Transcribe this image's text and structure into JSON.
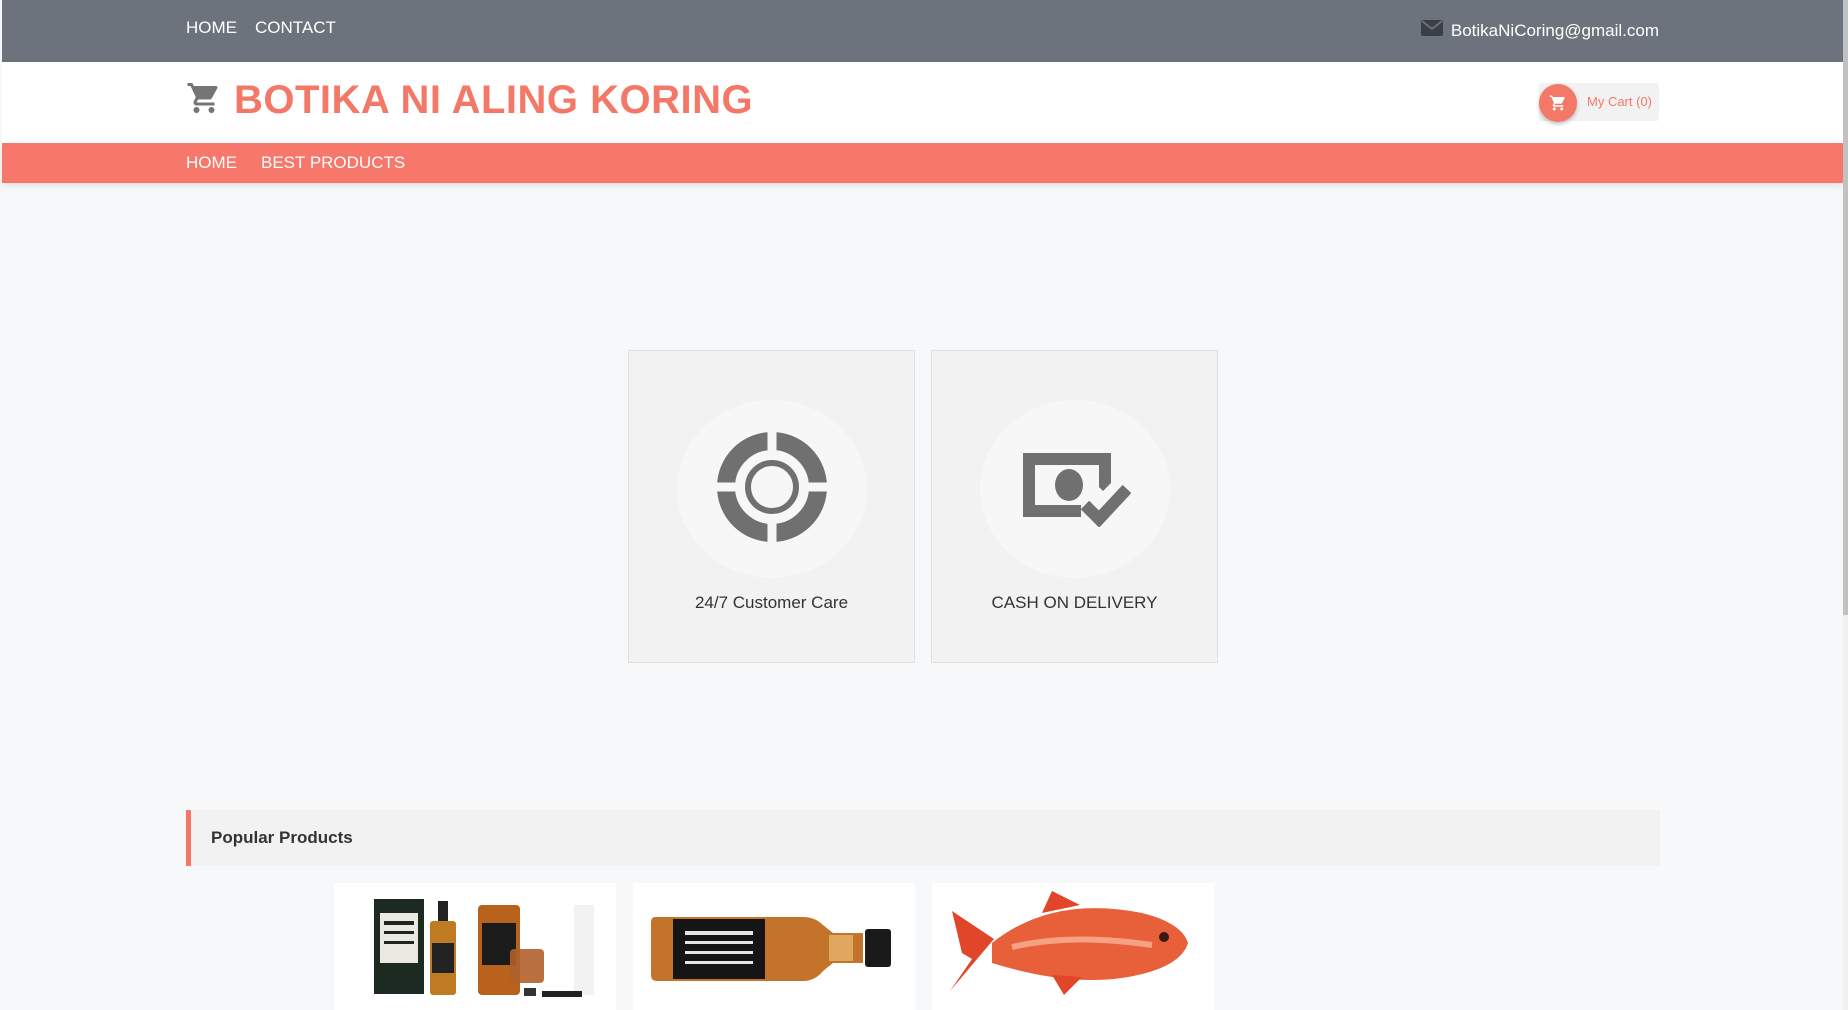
{
  "topbar": {
    "nav": [
      {
        "label": "HOME"
      },
      {
        "label": "CONTACT"
      }
    ],
    "email": "BotikaNiCoring@gmail.com"
  },
  "header": {
    "title": "BOTIKA NI ALING KORING",
    "cart_label": "My Cart (0)"
  },
  "mainnav": {
    "items": [
      {
        "label": "HOME"
      },
      {
        "label": "BEST PRODUCTS"
      }
    ]
  },
  "features": [
    {
      "label": "24/7 Customer Care",
      "icon": "lifebuoy-icon"
    },
    {
      "label": "CASH ON DELIVERY",
      "icon": "cash-check-icon"
    }
  ],
  "popular": {
    "title": "Popular Products"
  },
  "products": [
    {
      "image": "whiskey-set"
    },
    {
      "image": "whiskey-bottle"
    },
    {
      "image": "red-fish"
    }
  ],
  "colors": {
    "accent": "#f47868",
    "topbar": "#6c737c",
    "nav": "#f7776a"
  }
}
